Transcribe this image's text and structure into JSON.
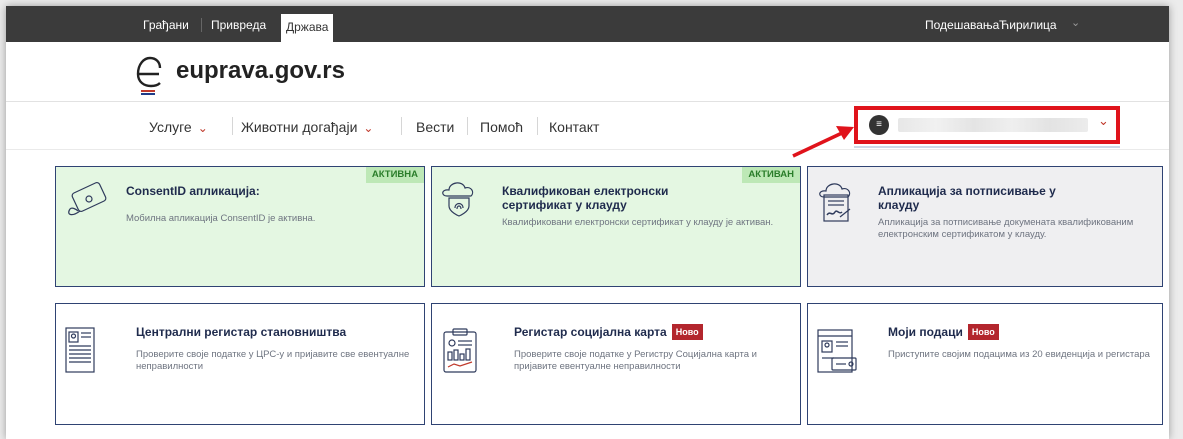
{
  "topbar": {
    "tabs": [
      "Грађани",
      "Привреда",
      "Држава"
    ],
    "settings": "Подешавања",
    "language": "Ћирилица",
    "chevron": "⌄"
  },
  "logo": {
    "text": "euprava.gov.rs"
  },
  "nav": {
    "items": [
      "Услуге",
      "Животни догађаји",
      "Вести",
      "Помоћ",
      "Контакт"
    ],
    "chevron": "⌄"
  },
  "user": {
    "chevron": "⌄",
    "avatar_glyph": "≡"
  },
  "cards": [
    {
      "title": "ConsentID апликација:",
      "badge": "АКТИВНА",
      "desc": "Мобилна апликација ConsentID је активна.",
      "icon": "id-card-icon"
    },
    {
      "title": "Квалификован електронски сертификат у клауду",
      "badge": "АКТИВАН",
      "desc": "Квалификовани електронски сертификат у клауду је активан.",
      "icon": "cloud-fingerprint-icon"
    },
    {
      "title": "Апликација за потписивање у клауду",
      "desc": "Апликација за потписивање докумената квалификованим електронским сертификатом у клауду.",
      "icon": "cloud-signature-icon"
    },
    {
      "title": "Централни регистар становништва",
      "desc": "Проверите своје податке у ЦРС-у и пријавите све евентуалне неправилности",
      "icon": "document-profile-icon"
    },
    {
      "title": "Регистар социјална карта",
      "new": "Ново",
      "desc": "Проверите своје податке у Регистру Социјална карта и пријавите евентуалне неправилности",
      "icon": "clipboard-chart-icon"
    },
    {
      "title": "Моји подаци",
      "new": "Ново",
      "desc": "Приступите својим подацима из 20 евиденција и регистара",
      "icon": "browser-profile-icon"
    }
  ],
  "colors": {
    "accent_red": "#e0131b",
    "navy": "#2f4373",
    "active_green": "#e4f7e2",
    "badge_green": "#bde8b6",
    "new_red": "#b3262d"
  }
}
